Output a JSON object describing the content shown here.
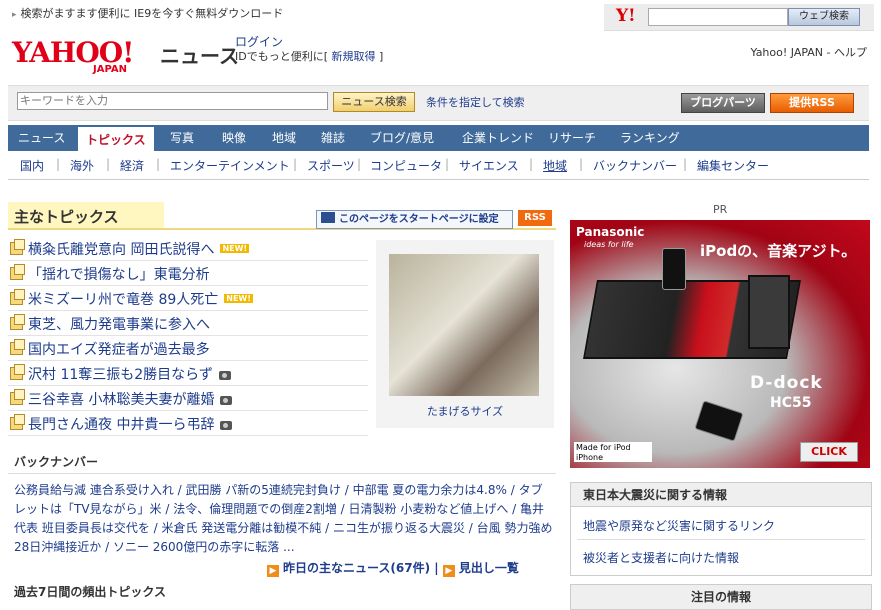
{
  "promo": {
    "text": "検索がますます便利に IE9を今すぐ無料ダウンロード"
  },
  "yahoo_search": {
    "logo": "Y!",
    "placeholder": "",
    "button": "ウェブ検索"
  },
  "header": {
    "logo": "YAHOO!",
    "logo_sub": "JAPAN",
    "service": "ニュース",
    "login": "ログイン",
    "login_sub_prefix": "IDでもっと便利に[",
    "register": "新規取得",
    "login_sub_suffix": "]",
    "top_links": "Yahoo! JAPAN - ヘルプ"
  },
  "search_row": {
    "placeholder": "キーワードを入力",
    "button": "ニュース検索",
    "advanced": "条件を指定して検索",
    "blog_parts": "ブログパーツ",
    "rss": "提供RSS"
  },
  "nav": {
    "tabs": [
      "ニュース",
      "トピックス",
      "写真",
      "映像",
      "地域",
      "雑誌",
      "ブログ/意見",
      "企業トレンド",
      "リサーチ",
      "ランキング"
    ],
    "active": "トピックス",
    "sub": [
      "国内",
      "海外",
      "経済",
      "エンターテインメント",
      "スポーツ",
      "コンピュータ",
      "サイエンス",
      "地域",
      "バックナンバー",
      "編集センター"
    ]
  },
  "topics": {
    "title": "主なトピックス",
    "set_start": "このページをスタートページに設定",
    "rss": "RSS",
    "items": [
      {
        "text": "横粂氏離党意向 岡田氏説得へ",
        "badge": "NEW!"
      },
      {
        "text": "「揺れで損傷なし」東電分析",
        "badge": ""
      },
      {
        "text": "米ミズーリ州で竜巻 89人死亡",
        "badge": "NEW!"
      },
      {
        "text": "東芝、風力発電事業に参入へ",
        "badge": ""
      },
      {
        "text": "国内エイズ発症者が過去最多",
        "badge": ""
      },
      {
        "text": "沢村 11奪三振も2勝目ならず",
        "badge": "camera"
      },
      {
        "text": "三谷幸喜 小林聡美夫妻が離婚",
        "badge": "camera"
      },
      {
        "text": "長門さん通夜 中井貴一ら弔辞",
        "badge": "camera"
      }
    ],
    "photo_caption": "たまげるサイズ"
  },
  "back_numbers": {
    "title": "バックナンバー",
    "text": "公務員給与減 連合系受け入れ / 武田勝 パ新の5連続完封負け / 中部電 夏の電力余力は4.8% / タブレットは「TV見ながら」米 / 法令、倫理問題での倒産2割増 / 日清製粉 小麦粉など値上げへ / 亀井代表 班目委員長は交代を / 米倉氏 発送電分離は勧模不純 / ニコ生が振り返る大震災 / 台風 勢力強め28日沖縄接近か / ソニー 2600億円の赤字に転落 ...",
    "yesterday": "昨日の主なニュース(67件)",
    "headline_list": "見出し一覧"
  },
  "frequent": {
    "title": "過去7日間の頻出トピックス"
  },
  "ad": {
    "pr": "PR",
    "brand": "Panasonic",
    "tagline": "ideas for life",
    "copy": "iPodの、音楽アジト。",
    "product": "D-dock",
    "model": "HC55",
    "madefor": "Made for iPod iPhone",
    "click": "CLICK"
  },
  "quake": {
    "title": "東日本大震災に関する情報",
    "link1": "地震や原発など災害に関するリンク",
    "link2": "被災者と支援者に向けた情報"
  },
  "notice": {
    "title": "注目の情報"
  },
  "colors": {
    "nav_bg": "#3f6a99",
    "brand_red": "#e00018",
    "link": "#1e3c8c"
  }
}
